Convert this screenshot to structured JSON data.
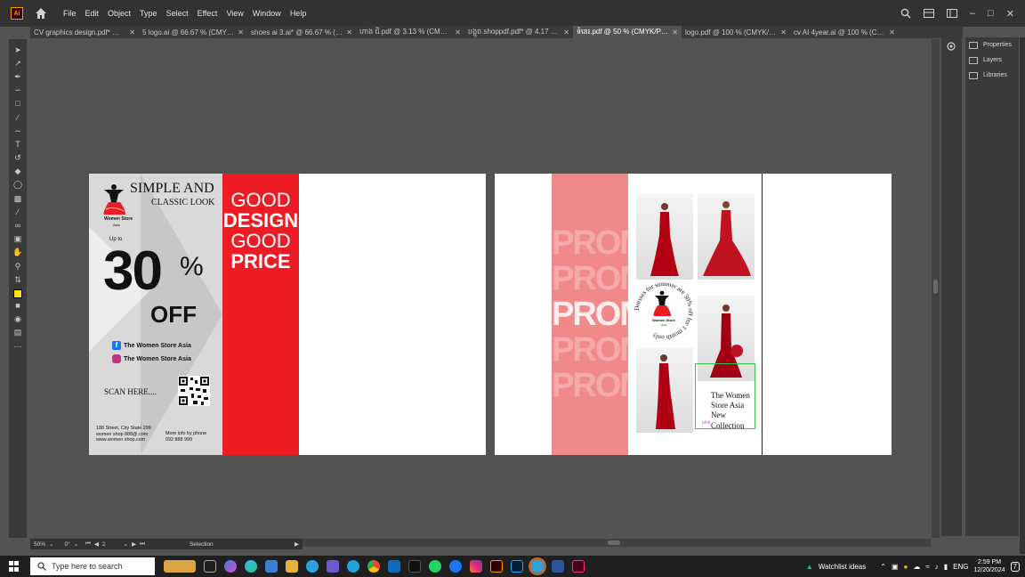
{
  "app": {
    "logo_text": "Ai"
  },
  "menu": [
    "File",
    "Edit",
    "Object",
    "Type",
    "Select",
    "Effect",
    "View",
    "Window",
    "Help"
  ],
  "tabs": [
    {
      "label": "CV graphics design.pdf* @ 100...",
      "active": false
    },
    {
      "label": "5 logo.ai @ 66.67 % (CMYK/Pr...",
      "active": false
    },
    {
      "label": "shoes ai 3.ai* @ 66.67 % (CMY...",
      "active": false
    },
    {
      "label": "ហាង ជិ.pdf @ 3.13 % (CMYK/P...",
      "active": false
    },
    {
      "label": "បង្អួច.shoppdf.pdf* @ 4.17 %...",
      "active": false
    },
    {
      "label": "ទំនេរ.pdf @ 50 % (CMYK/Preview)",
      "active": true
    },
    {
      "label": "logo.pdf @ 100 % (CMYK/Prev...",
      "active": false
    },
    {
      "label": "cv AI 4year.ai @ 100 % (CMYK...",
      "active": false
    }
  ],
  "panels": {
    "properties": "Properties",
    "layers": "Layers",
    "libraries": "Libraries"
  },
  "artboard1": {
    "title_line1": "SIMPLE AND",
    "title_line2": "CLASSIC LOOK",
    "brand_name": "Women Store",
    "brand_sub": "Asia",
    "up_to": "Up to",
    "big_number": "30",
    "percent": "%",
    "off": "OFF",
    "facebook": "The Women Store Asia",
    "instagram": "The Women Store Asia",
    "scan": "SCAN HERE....",
    "address": "188 Street, City State 299",
    "email": "women shop 888@.com",
    "website": "www.women shop.com",
    "more_info": "More info by phone",
    "phone": "092 888 999",
    "good1": "GOOD",
    "design": "DESIGN",
    "good2": "GOOD",
    "price": "PRICE"
  },
  "artboard2": {
    "promo": "PROMO",
    "circle_text": "Dresses for summer are 30% off for 1 month only",
    "brand_name": "Women Store",
    "brand_sub": "Asia",
    "collection_lines": [
      "The Women",
      "Store Asia",
      "New",
      "Collection"
    ],
    "small_label": "pink"
  },
  "status": {
    "zoom": "50%",
    "rotation": "0°",
    "artboard": "2",
    "tool": "Selection"
  },
  "taskbar": {
    "search_placeholder": "Type here to search",
    "widget": "Watchlist ideas",
    "lang": "ENG",
    "time": "2:59 PM",
    "date": "12/20/2024",
    "notifications": "7"
  },
  "colors": {
    "accent_red": "#ed1c24",
    "promo_pink": "#f08a8a",
    "fill_swatch": "#ffe600"
  }
}
